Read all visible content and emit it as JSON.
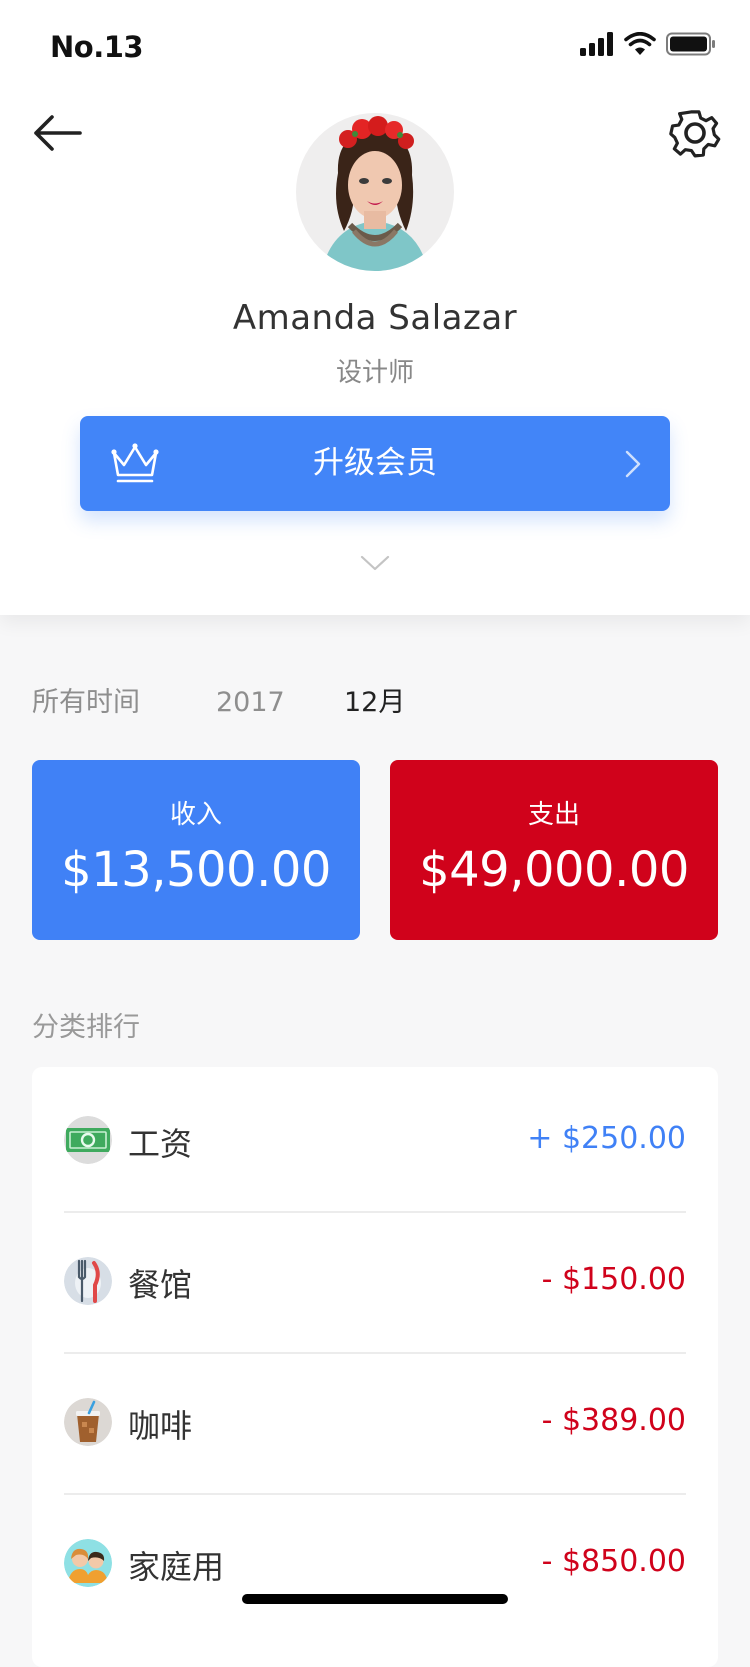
{
  "status_bar": {
    "time": "No.13",
    "icons": [
      "signal-icon",
      "wifi-icon",
      "battery-icon"
    ]
  },
  "header": {
    "back_icon": "arrow-left-icon",
    "settings_icon": "gear-icon"
  },
  "profile": {
    "name": "Amanda Salazar",
    "role": "设计师",
    "upgrade_label": "升级会员",
    "upgrade_icon": "crown-icon"
  },
  "filters": {
    "all_time": "所有时间",
    "year": "2017",
    "month": "12月",
    "selected": "12月"
  },
  "summary": {
    "income_label": "收入",
    "income_value": "$13,500.00",
    "expense_label": "支出",
    "expense_value": "$49,000.00"
  },
  "ranking": {
    "title": "分类排行",
    "items": [
      {
        "label": "工资",
        "amount": "+ $250.00",
        "icon": "cash-icon"
      },
      {
        "label": "餐馆",
        "amount": "- $150.00",
        "icon": "utensils-icon"
      },
      {
        "label": "咖啡",
        "amount": "- $389.00",
        "icon": "coffee-icon"
      },
      {
        "label": "家庭用",
        "amount": "- $850.00",
        "icon": "family-icon"
      }
    ]
  },
  "colors": {
    "primary_blue": "#4285f8",
    "expense_red": "#d0021b",
    "income_blue": "#4081f6"
  }
}
